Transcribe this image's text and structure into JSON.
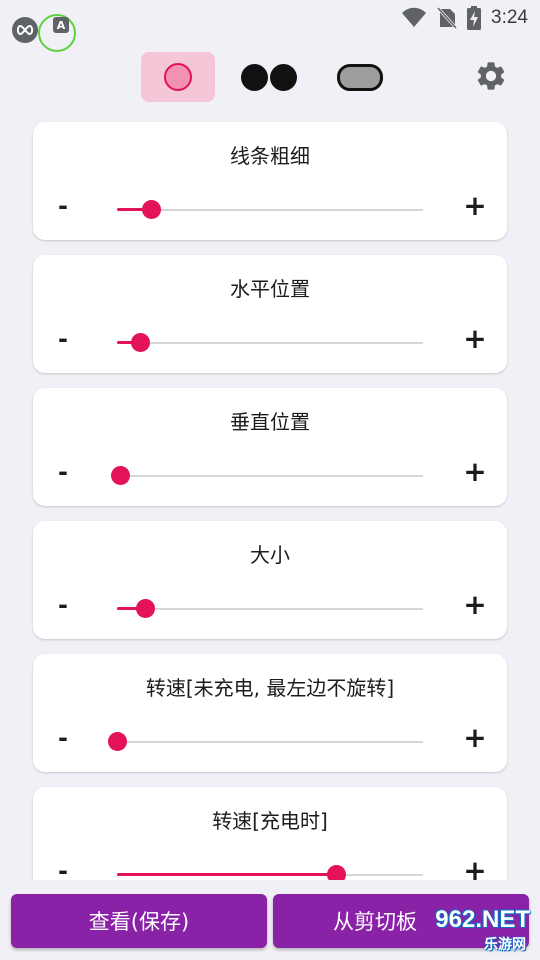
{
  "status_bar": {
    "time": "3:24",
    "left_icons": [
      "infinity-app-icon",
      "a-badge-icon"
    ],
    "right_icons": [
      "wifi-icon",
      "no-sim-icon",
      "battery-charging-icon"
    ]
  },
  "toolbar": {
    "shapes": [
      {
        "name": "circle-shape",
        "selected": true
      },
      {
        "name": "dual-circle-shape",
        "selected": false
      },
      {
        "name": "pill-shape",
        "selected": false
      }
    ],
    "settings_icon": "gear-icon"
  },
  "colors": {
    "accent": "#e4125a",
    "selected_bg": "#f4c6d7",
    "button_purple": "#8a22a8",
    "background": "#f1f0f6"
  },
  "settings": [
    {
      "title": "线条粗细",
      "minus": "-",
      "plus": "+",
      "value": 0.11
    },
    {
      "title": "水平位置",
      "minus": "-",
      "plus": "+",
      "value": 0.075
    },
    {
      "title": "垂直位置",
      "minus": "-",
      "plus": "+",
      "value": 0.01
    },
    {
      "title": "大小",
      "minus": "-",
      "plus": "+",
      "value": 0.09
    },
    {
      "title": "转速[未充电, 最左边不旋转]",
      "minus": "-",
      "plus": "+",
      "value": 0.0
    },
    {
      "title": "转速[充电时]",
      "minus": "-",
      "plus": "+",
      "value": 0.715
    }
  ],
  "actions": {
    "view_save": "查看(保存)",
    "from_clipboard": "从剪切板"
  },
  "watermark": {
    "number": "962.NET",
    "sub": "乐游网"
  }
}
